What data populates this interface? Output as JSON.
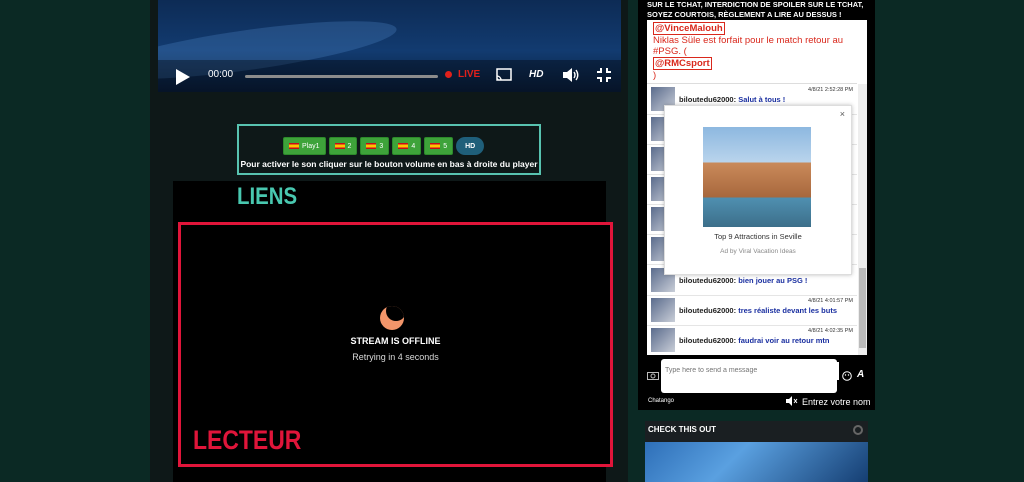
{
  "player": {
    "time": "00:00",
    "live_label": "LIVE",
    "hd_label": "HD"
  },
  "choices": {
    "buttons": [
      {
        "label": "Play1"
      },
      {
        "label": "2"
      },
      {
        "label": "3"
      },
      {
        "label": "4"
      },
      {
        "label": "5"
      }
    ],
    "hd_label": "HD",
    "hint": "Pour activer le son cliquer sur le bouton volume en bas à droite du player"
  },
  "sections": {
    "liens": "LIENS",
    "lecteur": "LECTEUR"
  },
  "stream": {
    "status": "STREAM IS OFFLINE",
    "retry": "Retrying in 4 seconds"
  },
  "chat": {
    "rules_line1": "SUR LE TCHAT, INTERDICTION DE SPOILER SUR LE TCHAT,",
    "rules_line2": "SOYEZ COURTOIS, RÈGLEMENT A LIRE AU DESSUS !",
    "pinned": {
      "mention1": "@VinceMalouh",
      "text": "Niklas Süle est forfait pour le match retour au #PSG. (",
      "mention2": "@RMCsport",
      "close": ")"
    },
    "messages": [
      {
        "time": "4/8/21 2:52:28 PM",
        "user": "biloutedu62000:",
        "text": "Salut à tous !"
      },
      {
        "time": "",
        "user": "biloutedu62000:",
        "text": "bien jouer au PSG !"
      },
      {
        "time": "4/8/21 4:01:57 PM",
        "user": "biloutedu62000:",
        "text": "tres réaliste devant les buts"
      },
      {
        "time": "4/8/21 4:02:35 PM",
        "user": "biloutedu62000:",
        "text": "faudrai voir au retour mtn"
      }
    ],
    "input_placeholder": "Type here to send a message",
    "brand": "Chatango",
    "name_prompt": "Entrez votre nom"
  },
  "ad": {
    "title": "Top 9 Attractions in Seville",
    "by": "Ad by Viral Vacation Ideas",
    "close": "×"
  },
  "check": {
    "title": "CHECK THIS OUT"
  }
}
